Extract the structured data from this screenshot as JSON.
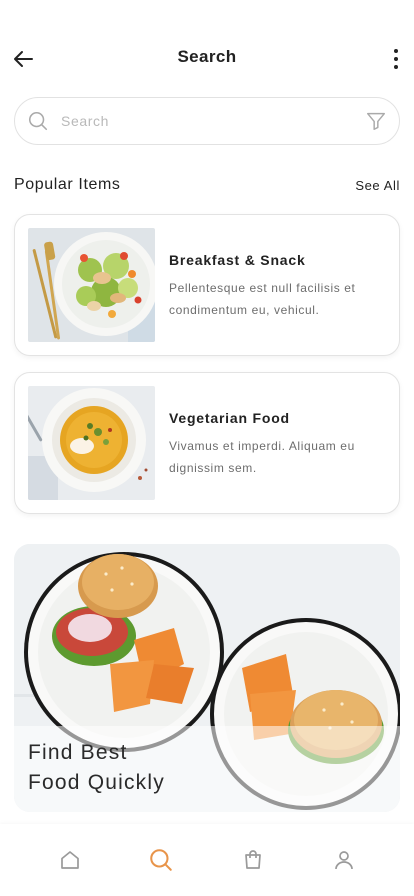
{
  "header": {
    "title": "Search",
    "back_icon": "arrow-left-icon",
    "more_icon": "more-vertical-icon"
  },
  "search": {
    "placeholder": "Search",
    "value": "",
    "search_icon": "search-icon",
    "filter_icon": "filter-icon"
  },
  "popular": {
    "title": "Popular Items",
    "see_all": "See All",
    "items": [
      {
        "title": "Breakfast & Snack",
        "description": "Pellentesque est null facilisis et condimentum eu, vehicul.",
        "image": "salad-plate-photo"
      },
      {
        "title": "Vegetarian Food",
        "description": "Vivamus et imperdi. Aliquam eu dignissim sem.",
        "image": "soup-bowl-photo"
      }
    ]
  },
  "promo": {
    "line1": "Find Best",
    "line2": "Food Quickly",
    "image": "burgers-and-chips-photo"
  },
  "tabbar": {
    "active": "search",
    "tabs": [
      {
        "name": "home",
        "icon": "home-icon"
      },
      {
        "name": "search",
        "icon": "search-icon"
      },
      {
        "name": "cart",
        "icon": "shopping-bag-icon"
      },
      {
        "name": "profile",
        "icon": "user-icon"
      }
    ]
  },
  "colors": {
    "accent": "#e8944a",
    "text": "#222222",
    "muted": "#6d6d6d",
    "border": "#e3e3e3",
    "icon_inactive": "#9a9a9a"
  }
}
